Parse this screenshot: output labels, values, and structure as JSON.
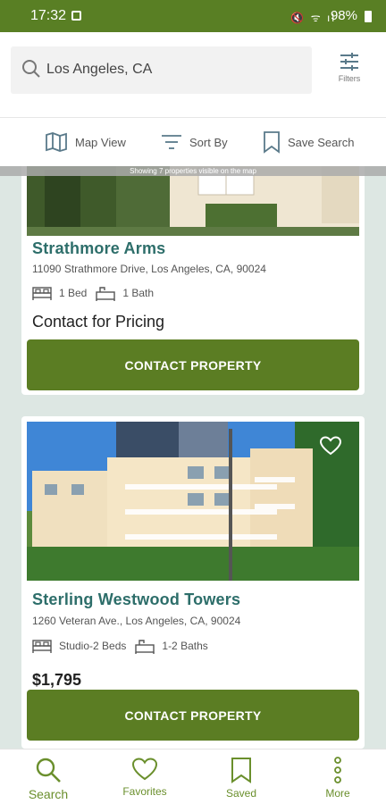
{
  "status_bar": {
    "time": "17:32",
    "battery": "98%"
  },
  "search": {
    "value": "Los Angeles, CA",
    "filters_label": "Filters"
  },
  "toolbar": {
    "map_view": "Map View",
    "sort_by": "Sort By",
    "save_search": "Save Search"
  },
  "map_note": "Showing 7 properties visible on the map",
  "listings": [
    {
      "name": "Strathmore Arms",
      "address": "11090 Strathmore Drive, Los Angeles, CA, 90024",
      "beds": "1 Bed",
      "baths": "1 Bath",
      "price": "Contact for Pricing",
      "button": "CONTACT PROPERTY"
    },
    {
      "name": "Sterling Westwood Towers",
      "address": "1260 Veteran Ave., Los Angeles, CA, 90024",
      "beds": "Studio-2 Beds",
      "baths": "1-2 Baths",
      "price": "$1,795",
      "button": "CONTACT PROPERTY"
    }
  ],
  "nav": {
    "search": "Search",
    "favorites": "Favorites",
    "saved": "Saved",
    "more": "More"
  },
  "colors": {
    "brand_green": "#5b7d23",
    "teal_title": "#2d6e6a",
    "background": "#dde7e3"
  }
}
